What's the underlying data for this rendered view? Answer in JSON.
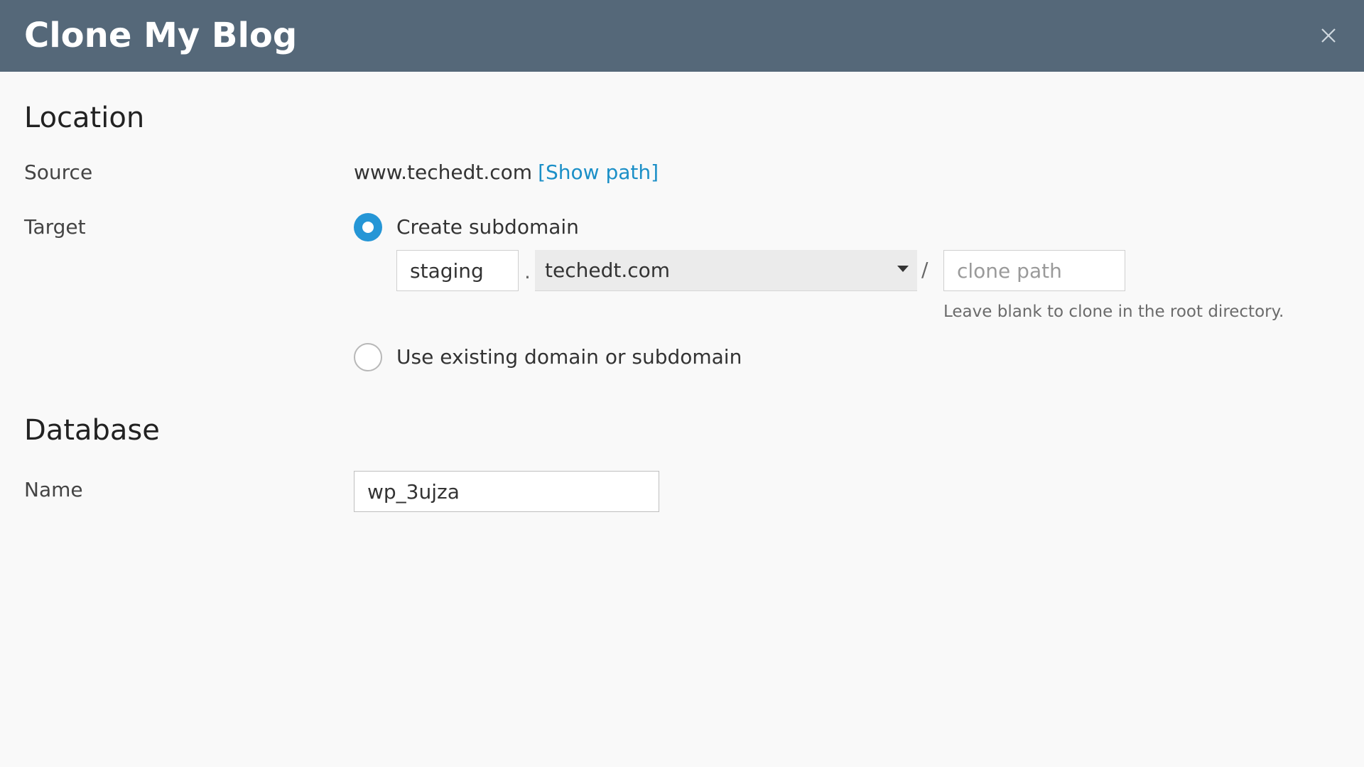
{
  "dialog": {
    "title": "Clone My Blog",
    "close_icon": "close-icon"
  },
  "location": {
    "heading": "Location",
    "source_label": "Source",
    "source_value": "www.techedt.com",
    "show_path_label": "[Show path]",
    "target_label": "Target",
    "options": [
      {
        "label": "Create subdomain",
        "selected": true
      },
      {
        "label": "Use existing domain or subdomain",
        "selected": false
      }
    ],
    "subdomain_value": "staging",
    "dot_separator": ".",
    "domain_selected": "techedt.com",
    "slash_separator": "/",
    "clone_path_placeholder": "clone path",
    "clone_path_value": "",
    "hint": "Leave blank to clone in the root directory."
  },
  "database": {
    "heading": "Database",
    "name_label": "Name",
    "name_value": "wp_3ujza"
  },
  "colors": {
    "titlebar": "#556879",
    "accent": "#2596d6",
    "link": "#1b8fc7",
    "background": "#f9f9f9"
  }
}
